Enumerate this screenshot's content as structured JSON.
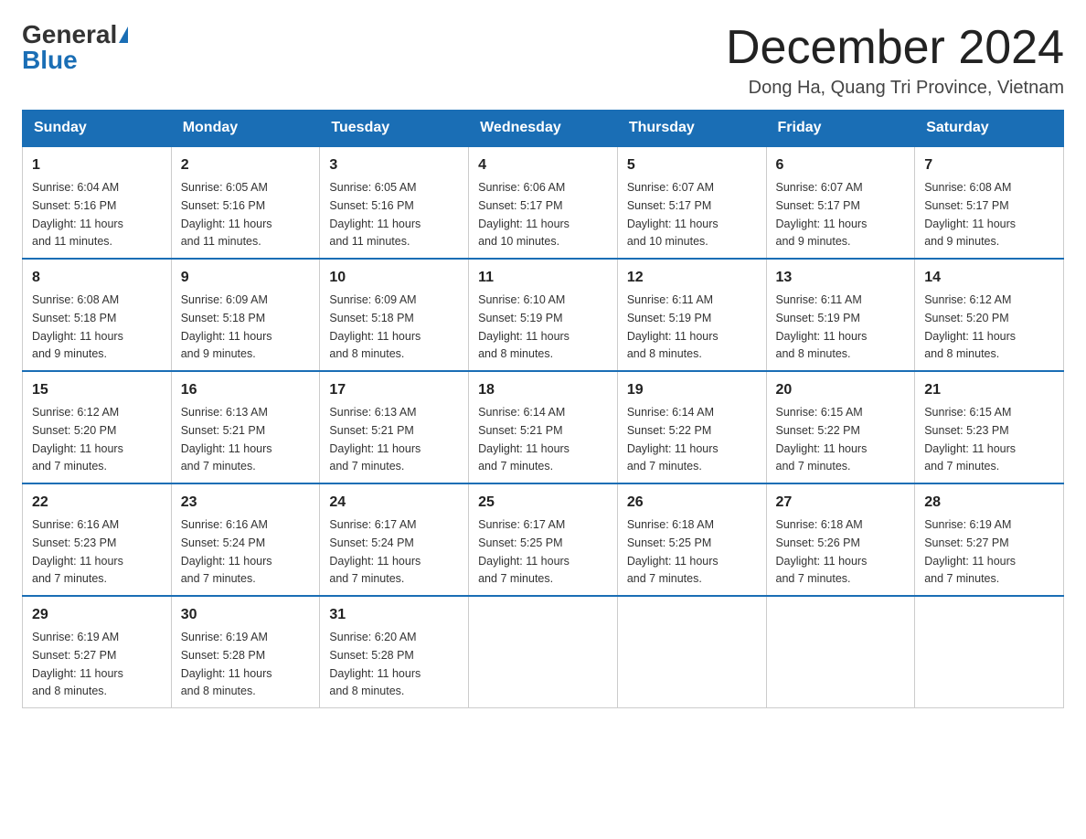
{
  "logo": {
    "general": "General",
    "blue": "Blue"
  },
  "title": "December 2024",
  "location": "Dong Ha, Quang Tri Province, Vietnam",
  "weekdays": [
    "Sunday",
    "Monday",
    "Tuesday",
    "Wednesday",
    "Thursday",
    "Friday",
    "Saturday"
  ],
  "weeks": [
    [
      {
        "day": "1",
        "sunrise": "6:04 AM",
        "sunset": "5:16 PM",
        "daylight": "11 hours and 11 minutes."
      },
      {
        "day": "2",
        "sunrise": "6:05 AM",
        "sunset": "5:16 PM",
        "daylight": "11 hours and 11 minutes."
      },
      {
        "day": "3",
        "sunrise": "6:05 AM",
        "sunset": "5:16 PM",
        "daylight": "11 hours and 11 minutes."
      },
      {
        "day": "4",
        "sunrise": "6:06 AM",
        "sunset": "5:17 PM",
        "daylight": "11 hours and 10 minutes."
      },
      {
        "day": "5",
        "sunrise": "6:07 AM",
        "sunset": "5:17 PM",
        "daylight": "11 hours and 10 minutes."
      },
      {
        "day": "6",
        "sunrise": "6:07 AM",
        "sunset": "5:17 PM",
        "daylight": "11 hours and 9 minutes."
      },
      {
        "day": "7",
        "sunrise": "6:08 AM",
        "sunset": "5:17 PM",
        "daylight": "11 hours and 9 minutes."
      }
    ],
    [
      {
        "day": "8",
        "sunrise": "6:08 AM",
        "sunset": "5:18 PM",
        "daylight": "11 hours and 9 minutes."
      },
      {
        "day": "9",
        "sunrise": "6:09 AM",
        "sunset": "5:18 PM",
        "daylight": "11 hours and 9 minutes."
      },
      {
        "day": "10",
        "sunrise": "6:09 AM",
        "sunset": "5:18 PM",
        "daylight": "11 hours and 8 minutes."
      },
      {
        "day": "11",
        "sunrise": "6:10 AM",
        "sunset": "5:19 PM",
        "daylight": "11 hours and 8 minutes."
      },
      {
        "day": "12",
        "sunrise": "6:11 AM",
        "sunset": "5:19 PM",
        "daylight": "11 hours and 8 minutes."
      },
      {
        "day": "13",
        "sunrise": "6:11 AM",
        "sunset": "5:19 PM",
        "daylight": "11 hours and 8 minutes."
      },
      {
        "day": "14",
        "sunrise": "6:12 AM",
        "sunset": "5:20 PM",
        "daylight": "11 hours and 8 minutes."
      }
    ],
    [
      {
        "day": "15",
        "sunrise": "6:12 AM",
        "sunset": "5:20 PM",
        "daylight": "11 hours and 7 minutes."
      },
      {
        "day": "16",
        "sunrise": "6:13 AM",
        "sunset": "5:21 PM",
        "daylight": "11 hours and 7 minutes."
      },
      {
        "day": "17",
        "sunrise": "6:13 AM",
        "sunset": "5:21 PM",
        "daylight": "11 hours and 7 minutes."
      },
      {
        "day": "18",
        "sunrise": "6:14 AM",
        "sunset": "5:21 PM",
        "daylight": "11 hours and 7 minutes."
      },
      {
        "day": "19",
        "sunrise": "6:14 AM",
        "sunset": "5:22 PM",
        "daylight": "11 hours and 7 minutes."
      },
      {
        "day": "20",
        "sunrise": "6:15 AM",
        "sunset": "5:22 PM",
        "daylight": "11 hours and 7 minutes."
      },
      {
        "day": "21",
        "sunrise": "6:15 AM",
        "sunset": "5:23 PM",
        "daylight": "11 hours and 7 minutes."
      }
    ],
    [
      {
        "day": "22",
        "sunrise": "6:16 AM",
        "sunset": "5:23 PM",
        "daylight": "11 hours and 7 minutes."
      },
      {
        "day": "23",
        "sunrise": "6:16 AM",
        "sunset": "5:24 PM",
        "daylight": "11 hours and 7 minutes."
      },
      {
        "day": "24",
        "sunrise": "6:17 AM",
        "sunset": "5:24 PM",
        "daylight": "11 hours and 7 minutes."
      },
      {
        "day": "25",
        "sunrise": "6:17 AM",
        "sunset": "5:25 PM",
        "daylight": "11 hours and 7 minutes."
      },
      {
        "day": "26",
        "sunrise": "6:18 AM",
        "sunset": "5:25 PM",
        "daylight": "11 hours and 7 minutes."
      },
      {
        "day": "27",
        "sunrise": "6:18 AM",
        "sunset": "5:26 PM",
        "daylight": "11 hours and 7 minutes."
      },
      {
        "day": "28",
        "sunrise": "6:19 AM",
        "sunset": "5:27 PM",
        "daylight": "11 hours and 7 minutes."
      }
    ],
    [
      {
        "day": "29",
        "sunrise": "6:19 AM",
        "sunset": "5:27 PM",
        "daylight": "11 hours and 8 minutes."
      },
      {
        "day": "30",
        "sunrise": "6:19 AM",
        "sunset": "5:28 PM",
        "daylight": "11 hours and 8 minutes."
      },
      {
        "day": "31",
        "sunrise": "6:20 AM",
        "sunset": "5:28 PM",
        "daylight": "11 hours and 8 minutes."
      },
      null,
      null,
      null,
      null
    ]
  ],
  "labels": {
    "sunrise": "Sunrise:",
    "sunset": "Sunset:",
    "daylight": "Daylight:"
  }
}
